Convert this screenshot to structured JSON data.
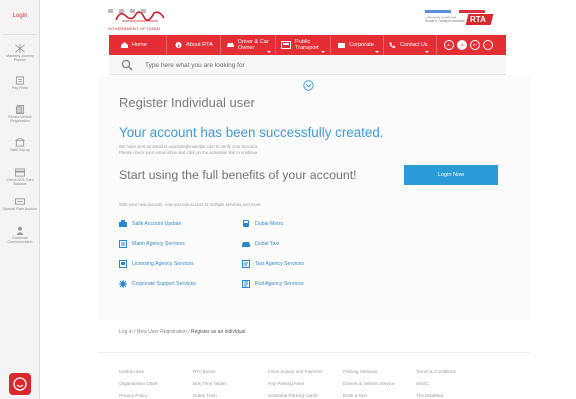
{
  "sidebar": {
    "login": "Login",
    "items": [
      {
        "icon": "mashreq-icon",
        "label": "Mashreq Journey Planner"
      },
      {
        "icon": "pay-fines-icon",
        "label": "Pay Fines"
      },
      {
        "icon": "renew-vehicle-icon",
        "label": "Renew Vehicle Registration"
      },
      {
        "icon": "salik-icon",
        "label": "Salik Top-up"
      },
      {
        "icon": "nol-card-icon",
        "label": "Check NOL Card Balance"
      },
      {
        "icon": "plate-icon",
        "label": "Special Plate Auction"
      },
      {
        "icon": "customer-icon",
        "label": "Customer Communication"
      }
    ]
  },
  "header": {
    "gov_label": "GOVERNMENT OF DUBAI",
    "rta_text": "هيئة الطرق والمواصلات Roads & Transport Authority",
    "rta_logo": "RTA"
  },
  "nav": {
    "items": [
      {
        "label": "Home",
        "icon": "home-icon"
      },
      {
        "label": "About RTA",
        "icon": "info-icon"
      },
      {
        "label": "Driver & Car Owner",
        "icon": "car-icon"
      },
      {
        "label": "Public Transport",
        "icon": "bus-icon"
      },
      {
        "label": "Corporate",
        "icon": "corporate-icon"
      },
      {
        "label": "Contact Us",
        "icon": "phone-icon"
      }
    ],
    "accessibility": [
      "A-",
      "A",
      "A+"
    ]
  },
  "search": {
    "placeholder": "Type here what you are looking for"
  },
  "main": {
    "title": "Register Individual user",
    "success": "Your account has been successfully created.",
    "note_line1": "We have sent an email to example@example.com to verify your account.",
    "note_line2": "Please check your email inbox and click on the activation link to continue.",
    "benefits_title": "Start using the full benefits of your account!",
    "benefits_note": "With your new account, now you can access to multiple services and more.",
    "login_button": "Login Now",
    "services": [
      {
        "label": "Salik Account Update",
        "icon": "salik-service-icon"
      },
      {
        "label": "Dubai Metro",
        "icon": "metro-icon"
      },
      {
        "label": "Marin Agency Services",
        "icon": "marine-icon"
      },
      {
        "label": "Dubai Taxi",
        "icon": "taxi-icon"
      },
      {
        "label": "Licensing Agency Services",
        "icon": "licensing-icon"
      },
      {
        "label": "Taxi Agency Services",
        "icon": "taxi-agency-icon"
      },
      {
        "label": "Corporate Support Services",
        "icon": "corporate-support-icon"
      },
      {
        "label": "Rail Agency Services",
        "icon": "rail-icon"
      }
    ]
  },
  "breadcrumb": {
    "a": "Log in",
    "b": "New User Registration",
    "c": "Register as an individual"
  },
  "footer": {
    "col1": [
      "Useful Links",
      "Organization Chart",
      "Privacy Policy"
    ],
    "col2": [
      "RTA Buses",
      "Bus Time Tables",
      "Dubai Tram"
    ],
    "col3": [
      "Fines Inquiry and Payment",
      "Pay Parking Fees",
      "Seasonal Parking Cards"
    ],
    "col4": [
      "Parking Services",
      "Drivers & Vehicle Service",
      "Book a Taxi"
    ],
    "col5": [
      "Terms & Conditions",
      "eNOC",
      "The Disabled"
    ]
  },
  "colors": {
    "brand_red": "#e32e35",
    "accent_blue": "#3f9bd2",
    "button_blue": "#2a9bd6"
  }
}
